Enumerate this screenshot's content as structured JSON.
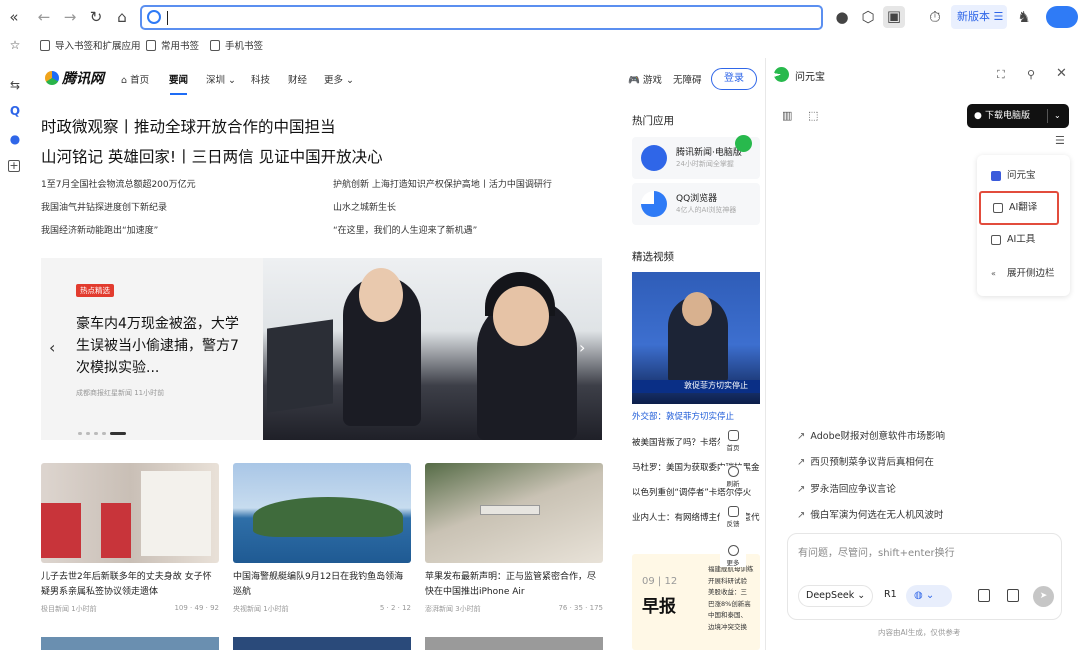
{
  "browser": {
    "version_label": "新版本",
    "bookmarks": [
      "导入书签和扩展应用",
      "常用书签",
      "手机书签"
    ]
  },
  "news": {
    "brand": "腾讯网",
    "nav": [
      "首页",
      "要闻",
      "深圳",
      "科技",
      "财经",
      "更多"
    ],
    "right_links": [
      "游戏",
      "无障碍"
    ],
    "login": "登录",
    "headline1": "时政微观察丨推动全球开放合作的中国担当",
    "headline2": "山河铭记 英雄回家!丨三日两信 见证中国开放决心",
    "subs_left": [
      "1至7月全国社会物流总额超200万亿元",
      "我国油气井钻探进度创下新纪录",
      "我国经济新动能跑出“加速度”"
    ],
    "subs_right": [
      "护航创新 上海打造知识产权保护高地丨活力中国调研行",
      "山水之城新生长",
      "“在这里，我们的人生迎来了新机遇”"
    ],
    "hero": {
      "tag": "热点精选",
      "title": "豪车内4万现金被盗，大学生误被当小偷逮捕，警方7次模拟实验...",
      "meta": "成都商报红星新闻 11小时前"
    },
    "cards": [
      {
        "title": "儿子去世2年后新联多年的丈夫身故 女子怀疑男系亲属私签协议领走遗体",
        "source": "极目新闻 1小时前",
        "stats": "109 · 49 · 92"
      },
      {
        "title": "中国海警舰艇编队9月12日在我钓鱼岛领海巡航",
        "source": "央视新闻 1小时前",
        "stats": "5 · 2 · 12"
      },
      {
        "title": "苹果发布最新声明：正与监管紧密合作，尽快在中国推出iPhone Air",
        "source": "澎湃新闻 3小时前",
        "stats": "76 · 35 · 175"
      }
    ],
    "hot_apps_title": "热门应用",
    "apps": [
      {
        "name": "腾讯新闻·电脑版",
        "desc": "24小时新闻全掌握"
      },
      {
        "name": "QQ浏览器",
        "desc": "4亿人的AI浏览神器"
      }
    ],
    "video_title": "精选视频",
    "video_caption": "外交部：敦促菲方切实停止",
    "video_overlay": "敦促菲方切实停止",
    "video_list": [
      "被美国背叛了吗？卡塔尔首相",
      "马杜罗：美国为获取委内瑞拉黑金",
      "以色列重创“调停者”卡塔尔停火",
      "业内人士：有网络博主借用恶意代码"
    ],
    "date_card": {
      "date": "09 | 12",
      "word": "早报",
      "lines": [
        "福建舰航母训练",
        "开展科研试验",
        "美股收益：三",
        "巴涨8%创新高",
        "中国和泰国、",
        "边境冲突交换"
      ]
    },
    "float_tools": [
      "首页",
      "刷新",
      "反馈",
      "更多"
    ]
  },
  "panel": {
    "title": "问元宝",
    "download": "下载电脑版",
    "menu": [
      "问元宝",
      "AI翻译",
      "AI工具",
      "展开侧边栏"
    ],
    "suggestions": [
      "Adobe财报对创意软件市场影响",
      "西贝预制菜争议背后真相何在",
      "罗永浩回应争议言论",
      "俄白军演为何选在无人机风波时"
    ],
    "placeholder": "有问题，尽管问，shift+enter换行",
    "model": "DeepSeek",
    "r1": "R1",
    "footer": "内容由AI生成，仅供参考"
  }
}
